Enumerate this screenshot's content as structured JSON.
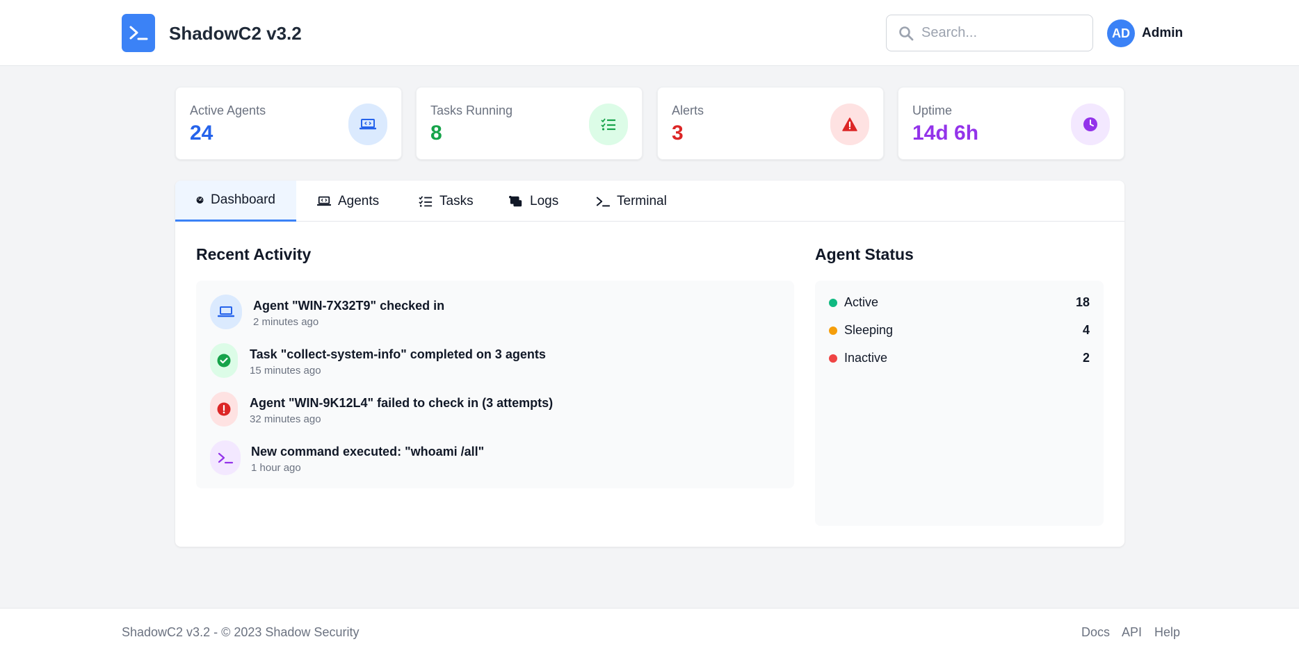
{
  "app": {
    "title": "ShadowC2 v3.2",
    "logo_icon": "terminal-prompt-icon",
    "brand_color": "#3b82f6"
  },
  "header": {
    "search": {
      "placeholder": "Search...",
      "value": ""
    },
    "user": {
      "initials": "AD",
      "name": "Admin"
    }
  },
  "stats": [
    {
      "label": "Active Agents",
      "value": "24",
      "icon": "laptop-code-icon",
      "color": "#2563eb",
      "bg": "#dbeafe"
    },
    {
      "label": "Tasks Running",
      "value": "8",
      "icon": "list-check-icon",
      "color": "#16a34a",
      "bg": "#dcfce7"
    },
    {
      "label": "Alerts",
      "value": "3",
      "icon": "warning-triangle-icon",
      "color": "#dc2626",
      "bg": "#fee2e2"
    },
    {
      "label": "Uptime",
      "value": "14d 6h",
      "icon": "clock-icon",
      "color": "#9333ea",
      "bg": "#f3e8ff"
    }
  ],
  "tabs": [
    {
      "label": "Dashboard",
      "icon": "gauge-icon",
      "active": true
    },
    {
      "label": "Agents",
      "icon": "laptop-icon",
      "active": false
    },
    {
      "label": "Tasks",
      "icon": "tasks-icon",
      "active": false
    },
    {
      "label": "Logs",
      "icon": "scroll-icon",
      "active": false
    },
    {
      "label": "Terminal",
      "icon": "terminal-icon",
      "active": false
    }
  ],
  "recent_activity": {
    "title": "Recent Activity",
    "items": [
      {
        "text": "Agent \"WIN-7X32T9\" checked in",
        "time": "2 minutes ago",
        "icon": "laptop-icon",
        "color": "#2563eb",
        "bg": "#dbeafe"
      },
      {
        "text": "Task \"collect-system-info\" completed on 3 agents",
        "time": "15 minutes ago",
        "icon": "check-circle-icon",
        "color": "#16a34a",
        "bg": "#dcfce7"
      },
      {
        "text": "Agent \"WIN-9K12L4\" failed to check in (3 attempts)",
        "time": "32 minutes ago",
        "icon": "exclamation-circle-icon",
        "color": "#dc2626",
        "bg": "#fee2e2"
      },
      {
        "text": "New command executed: \"whoami /all\"",
        "time": "1 hour ago",
        "icon": "terminal-icon",
        "color": "#9333ea",
        "bg": "#f3e8ff"
      }
    ]
  },
  "agent_status": {
    "title": "Agent Status",
    "rows": [
      {
        "label": "Active",
        "count": "18",
        "color": "#10b981"
      },
      {
        "label": "Sleeping",
        "count": "4",
        "color": "#f59e0b"
      },
      {
        "label": "Inactive",
        "count": "2",
        "color": "#ef4444"
      }
    ]
  },
  "footer": {
    "text": "ShadowC2 v3.2 - © 2023 Shadow Security",
    "links": [
      "Docs",
      "API",
      "Help"
    ]
  }
}
